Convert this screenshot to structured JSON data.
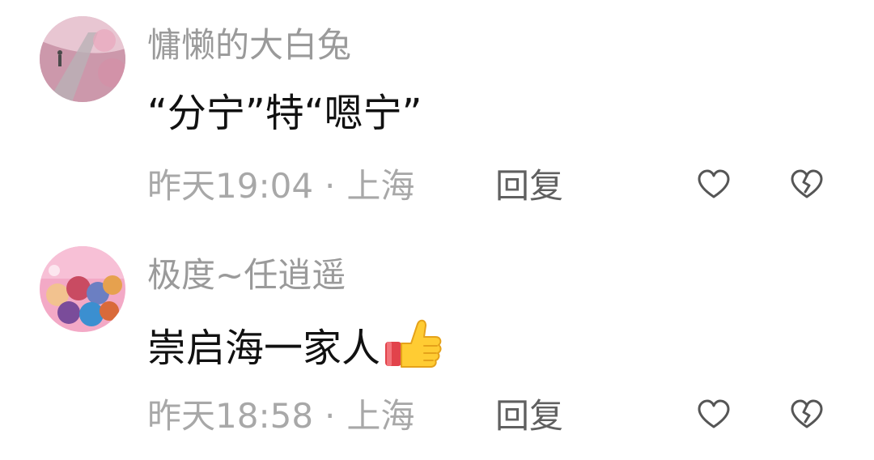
{
  "comments": [
    {
      "username": "慵懒的大白兔",
      "content": "“分宁”特“嗯宁”",
      "time": "昨天19:04",
      "separator": "·",
      "location": "上海",
      "reply_label": "回复",
      "has_thumbs_up_emoji": false
    },
    {
      "username": "极度~任逍遥",
      "content": "崇启海一家人",
      "time": "昨天18:58",
      "separator": "·",
      "location": "上海",
      "reply_label": "回复",
      "has_thumbs_up_emoji": true
    }
  ],
  "icons": {
    "like": "heart-outline-icon",
    "dislike": "broken-heart-outline-icon",
    "emoji": "thumbs-up-emoji"
  },
  "colors": {
    "username": "#9a9a9a",
    "content": "#111111",
    "meta": "#a8a8a8",
    "reply": "#606060",
    "icon_stroke": "#555555"
  }
}
